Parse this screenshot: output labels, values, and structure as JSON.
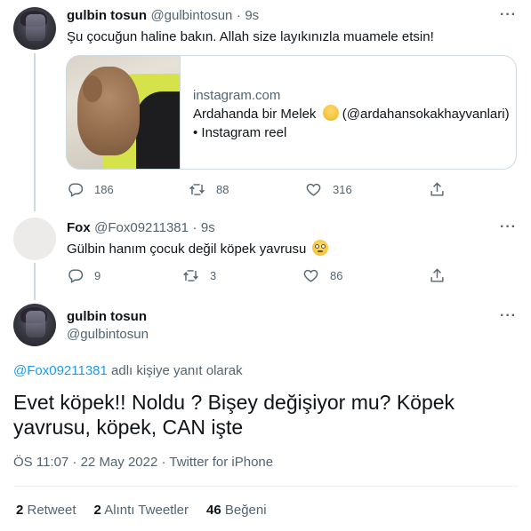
{
  "tweet1": {
    "name": "gulbin tosun",
    "handle": "@gulbintosun",
    "dot": "·",
    "time": "9s",
    "text": "Şu çocuğun haline bakın. Allah size layıkınızla muamele etsin!",
    "more": "···",
    "card": {
      "domain": "instagram.com",
      "title": "Ardahanda bir Melek",
      "title_suffix": " (@ardahansokakhayvanlari)",
      "subtitle": "• Instagram reel"
    },
    "replies": "186",
    "retweets": "88",
    "likes": "316"
  },
  "tweet2": {
    "name": "Fox",
    "handle": "@Fox09211381",
    "dot": "·",
    "time": "9s",
    "text": "Gülbin hanım çocuk değil köpek yavrusu",
    "more": "···",
    "replies": "9",
    "retweets": "3",
    "likes": "86"
  },
  "tweet3": {
    "name": "gulbin tosun",
    "handle": "@gulbintosun",
    "more": "···",
    "reply_to_mention": "@Fox09211381",
    "reply_to_suffix": " adlı kişiye yanıt olarak",
    "text_line1": "Evet köpek!! Noldu ? Bişey değişiyor mu? Köpek",
    "text_line2": "yavrusu, köpek, CAN işte",
    "meta": "ÖS 11:07 · 22 May 2022 · Twitter for iPhone",
    "stats": {
      "retweet_count": "2",
      "retweet_label": " Retweet",
      "quote_count": "2",
      "quote_label": " Alıntı Tweetler",
      "like_count": "46",
      "like_label": " Beğeni"
    }
  },
  "colors": {
    "accent": "#1d9bf0",
    "secondary_text": "#536471",
    "primary_text": "#0f1419",
    "border": "#cfd9de"
  }
}
